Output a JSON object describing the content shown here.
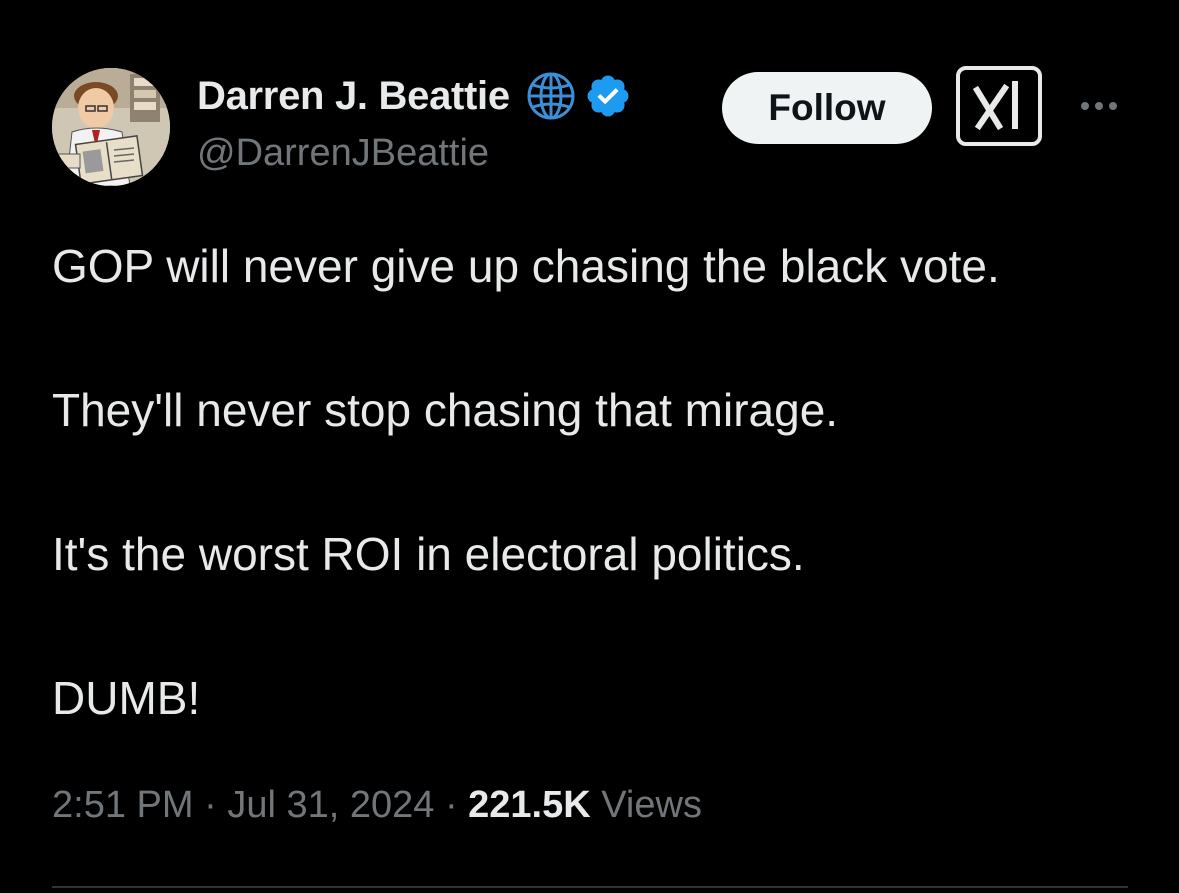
{
  "author": {
    "display_name": "Darren J. Beattie",
    "handle": "@DarrenJBeattie",
    "avatar_icon": "cartoon-man-reading-book-avatar",
    "affiliate_badge_icon": "globe-icon",
    "verified_badge_icon": "verified-check-icon"
  },
  "actions": {
    "follow_label": "Follow",
    "grok_icon": "grok-icon",
    "more_icon": "more-dots-icon"
  },
  "tweet": {
    "paragraphs": [
      "GOP will never give up chasing the black vote.",
      "They'll never stop chasing that mirage.",
      "It's the worst ROI in electoral politics.",
      "DUMB!"
    ]
  },
  "meta": {
    "time": "2:51 PM",
    "separator": "·",
    "date": "Jul 31, 2024",
    "views_count": "221.5K",
    "views_label": "Views"
  },
  "colors": {
    "background": "#000000",
    "primary_text": "#e7e9ea",
    "secondary_text": "#71767b",
    "verified_blue": "#1d9bf0",
    "follow_button_bg": "#eff3f4"
  }
}
